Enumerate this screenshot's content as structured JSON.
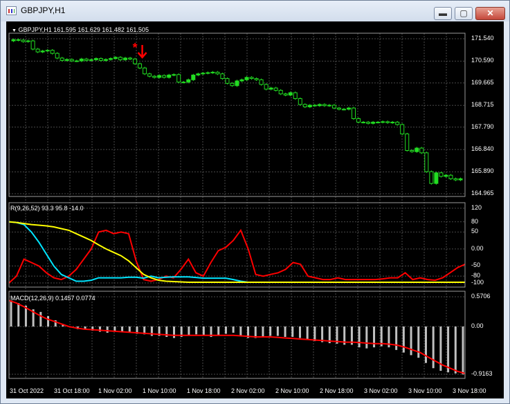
{
  "window": {
    "title": "GBPJPY,H1",
    "buttons": {
      "minimize": "▬",
      "maximize": "▢",
      "close": "✕"
    }
  },
  "price_pane": {
    "header": "GBPJPY,H1  161.595 161.629 161.482 161.505",
    "price_axis": [
      "171.540",
      "170.590",
      "169.665",
      "168.715",
      "167.790",
      "166.840",
      "165.890",
      "164.965"
    ],
    "bull_color": "#22dd22",
    "bear_color": "#000000",
    "marker_color": "#ff0000",
    "marker_star": "*",
    "marker_arrow": "arrow-down-icon"
  },
  "stoch_pane": {
    "header": "R(9,26,52) 93.3 95.8 -14.0",
    "axis": [
      "120",
      "80",
      "50",
      "0.00",
      "-50",
      "-80",
      "-100"
    ],
    "colors": {
      "fast": "#ff0000",
      "mid": "#00e5ff",
      "slow": "#ffff00"
    }
  },
  "macd_pane": {
    "header": "MACD(12,26,9) 0.1457 0.0774",
    "axis": [
      "0.5706",
      "0.00",
      "-0.9163"
    ],
    "hist_color": "#c0c0c0",
    "signal_color": "#ff0000"
  },
  "time_axis": [
    "31 Oct 2022",
    "31 Oct 18:00",
    "1 Nov 02:00",
    "1 Nov 10:00",
    "1 Nov 18:00",
    "2 Nov 02:00",
    "2 Nov 10:00",
    "2 Nov 18:00",
    "3 Nov 02:00",
    "3 Nov 10:00",
    "3 Nov 18:00"
  ],
  "chart_data": [
    {
      "type": "candlestick",
      "title": "GBPJPY,H1",
      "ylim": [
        164.965,
        171.54
      ],
      "close": [
        171.5,
        171.48,
        171.42,
        171.45,
        171.1,
        170.98,
        171.02,
        171.05,
        170.92,
        170.72,
        170.62,
        170.66,
        170.6,
        170.6,
        170.68,
        170.62,
        170.65,
        170.7,
        170.62,
        170.66,
        170.7,
        170.75,
        170.65,
        170.72,
        170.68,
        170.48,
        170.3,
        170.05,
        169.95,
        169.9,
        169.98,
        169.9,
        170.0,
        170.02,
        169.7,
        169.7,
        169.8,
        170.0,
        170.05,
        170.08,
        170.1,
        170.12,
        170.05,
        169.85,
        169.65,
        169.55,
        169.75,
        169.8,
        169.9,
        169.85,
        169.8,
        169.6,
        169.4,
        169.45,
        169.35,
        169.2,
        169.15,
        169.25,
        169.0,
        168.75,
        168.65,
        168.72,
        168.7,
        168.75,
        168.7,
        168.72,
        168.6,
        168.55,
        168.55,
        168.6,
        168.15,
        168.0,
        168.0,
        167.95,
        168.0,
        168.0,
        168.02,
        167.98,
        168.0,
        167.9,
        167.5,
        166.8,
        166.75,
        166.9,
        166.7,
        165.9,
        165.4,
        165.85,
        165.7,
        165.75,
        165.6,
        165.55,
        165.6
      ]
    },
    {
      "type": "line",
      "ylim": [
        -100,
        120
      ],
      "series": [
        {
          "name": "fast",
          "values": [
            -100,
            -80,
            -30,
            -40,
            -50,
            -70,
            -85,
            -90,
            -80,
            -60,
            -30,
            0,
            50,
            55,
            45,
            50,
            45,
            -35,
            -90,
            -95,
            -90,
            -80,
            -85,
            -60,
            -30,
            -70,
            -80,
            -40,
            -5,
            5,
            25,
            55,
            0,
            -75,
            -80,
            -75,
            -70,
            -60,
            -40,
            -45,
            -80,
            -85,
            -90,
            -90,
            -85,
            -90,
            -90,
            -90,
            -90,
            -90,
            -88,
            -85,
            -85,
            -70,
            -90,
            -85,
            -90,
            -92,
            -85,
            -70,
            -55,
            -45
          ]
        },
        {
          "name": "mid",
          "values": [
            80,
            78,
            72,
            50,
            20,
            -15,
            -50,
            -75,
            -85,
            -95,
            -95,
            -92,
            -85,
            -85,
            -85,
            -85,
            -83,
            -83,
            -86,
            -80,
            -85,
            -83,
            -82,
            -82,
            -82,
            -84,
            -86,
            -86,
            -86,
            -86,
            -90,
            -95,
            -98,
            -98,
            -98,
            -98,
            -98,
            -98,
            -98,
            -98,
            -98,
            -98,
            -98,
            -98,
            -98,
            -98,
            -98,
            -98,
            -98,
            -98,
            -98,
            -98,
            -98,
            -98,
            -98,
            -98,
            -98,
            -98,
            -98,
            -98,
            -98,
            -98
          ]
        },
        {
          "name": "slow",
          "values": [
            80,
            78,
            75,
            72,
            70,
            68,
            65,
            60,
            55,
            45,
            35,
            25,
            12,
            0,
            -10,
            -20,
            -35,
            -55,
            -75,
            -85,
            -92,
            -95,
            -96,
            -97,
            -98,
            -98,
            -98,
            -98,
            -98,
            -98,
            -98,
            -98,
            -98,
            -98,
            -98,
            -98,
            -98,
            -98,
            -98,
            -98,
            -98,
            -98,
            -98,
            -98,
            -98,
            -98,
            -98,
            -98,
            -98,
            -98,
            -98,
            -98,
            -98,
            -98,
            -98,
            -98,
            -98,
            -98,
            -98,
            -98,
            -98,
            -98
          ]
        }
      ]
    },
    {
      "type": "bar",
      "ylim": [
        -0.9163,
        0.5706
      ],
      "histogram": [
        0.5,
        0.45,
        0.4,
        0.33,
        0.28,
        0.2,
        0.12,
        0.05,
        0.0,
        -0.05,
        -0.06,
        -0.08,
        -0.1,
        -0.12,
        -0.1,
        -0.11,
        -0.12,
        -0.14,
        -0.15,
        -0.18,
        -0.18,
        -0.2,
        -0.22,
        -0.2,
        -0.18,
        -0.15,
        -0.18,
        -0.2,
        -0.18,
        -0.14,
        -0.12,
        -0.18,
        -0.22,
        -0.22,
        -0.2,
        -0.18,
        -0.18,
        -0.2,
        -0.2,
        -0.22,
        -0.25,
        -0.28,
        -0.3,
        -0.32,
        -0.33,
        -0.35,
        -0.35,
        -0.4,
        -0.42,
        -0.4,
        -0.38,
        -0.4,
        -0.45,
        -0.5,
        -0.55,
        -0.6,
        -0.7,
        -0.8,
        -0.85,
        -0.88,
        -0.9,
        -0.92
      ],
      "signal": [
        0.5,
        0.45,
        0.38,
        0.3,
        0.22,
        0.15,
        0.1,
        0.05,
        0.0,
        -0.03,
        -0.05,
        -0.06,
        -0.07,
        -0.08,
        -0.09,
        -0.1,
        -0.11,
        -0.12,
        -0.13,
        -0.14,
        -0.15,
        -0.16,
        -0.17,
        -0.17,
        -0.17,
        -0.17,
        -0.17,
        -0.17,
        -0.17,
        -0.17,
        -0.17,
        -0.18,
        -0.19,
        -0.2,
        -0.2,
        -0.2,
        -0.21,
        -0.22,
        -0.23,
        -0.24,
        -0.25,
        -0.26,
        -0.27,
        -0.28,
        -0.29,
        -0.3,
        -0.3,
        -0.31,
        -0.32,
        -0.33,
        -0.33,
        -0.34,
        -0.36,
        -0.4,
        -0.45,
        -0.5,
        -0.58,
        -0.66,
        -0.74,
        -0.8,
        -0.86,
        -0.9
      ]
    }
  ]
}
